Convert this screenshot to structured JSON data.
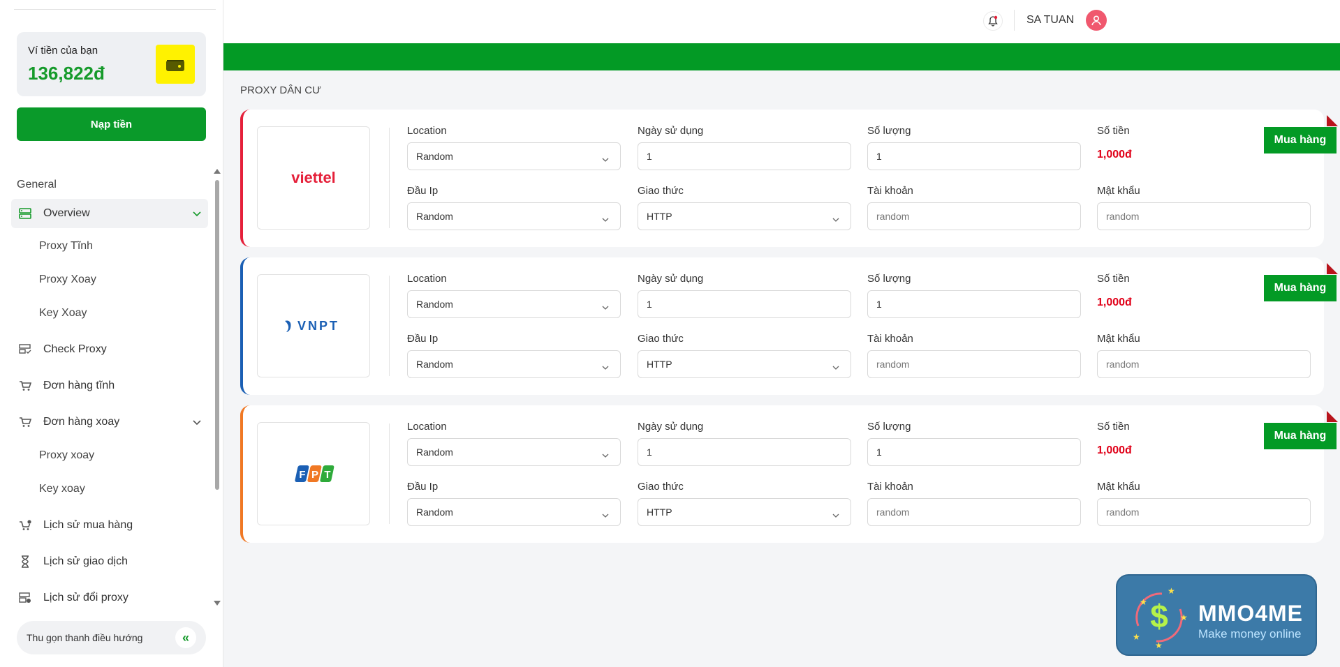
{
  "wallet": {
    "label": "Ví tiền của bạn",
    "amount": "136,822đ",
    "topup_label": "Nạp tiền"
  },
  "nav": {
    "section": "General",
    "items": [
      {
        "label": "Overview",
        "icon": "server-icon",
        "active": true
      },
      {
        "label": "Proxy Tĩnh"
      },
      {
        "label": "Proxy Xoay"
      },
      {
        "label": "Key Xoay"
      },
      {
        "label": "Check Proxy",
        "icon": "check-list-icon"
      },
      {
        "label": "Đơn hàng tĩnh",
        "icon": "cart-icon"
      },
      {
        "label": "Đơn hàng xoay",
        "icon": "cart-icon"
      },
      {
        "label": "Proxy xoay"
      },
      {
        "label": "Key xoay"
      },
      {
        "label": "Lịch sử mua hàng",
        "icon": "cart-history-icon"
      },
      {
        "label": "Lịch sử giao dịch",
        "icon": "hourglass-icon"
      },
      {
        "label": "Lịch sử đổi proxy",
        "icon": "server-history-icon"
      }
    ],
    "collapse_label": "Thu gọn thanh điều hướng"
  },
  "header": {
    "username": "SA TUAN"
  },
  "page_title": "PROXY DÂN CƯ",
  "labels": {
    "location": "Location",
    "days": "Ngày sử dụng",
    "quantity": "Số lượng",
    "price": "Số tiền",
    "ip_prefix": "Đầu Ip",
    "protocol": "Giao thức",
    "account": "Tài khoản",
    "password": "Mật khẩu",
    "buy": "Mua hàng"
  },
  "cards": [
    {
      "provider": "viettel",
      "location": "Random",
      "days": "1",
      "quantity": "1",
      "price": "1,000đ",
      "ip_prefix": "Random",
      "protocol": "HTTP",
      "account_placeholder": "random",
      "password_placeholder": "random"
    },
    {
      "provider": "VNPT",
      "location": "Random",
      "days": "1",
      "quantity": "1",
      "price": "1,000đ",
      "ip_prefix": "Random",
      "protocol": "HTTP",
      "account_placeholder": "random",
      "password_placeholder": "random"
    },
    {
      "provider": "FPT",
      "location": "Random",
      "days": "1",
      "quantity": "1",
      "price": "1,000đ",
      "ip_prefix": "Random",
      "protocol": "HTTP",
      "account_placeholder": "random",
      "password_placeholder": "random"
    }
  ],
  "watermark": {
    "title": "MMO4ME",
    "subtitle": "Make money online"
  },
  "colors": {
    "brand_green": "#039a25",
    "price_red": "#e00018",
    "viettel_red": "#e5203a",
    "vnpt_blue": "#1a5fb4",
    "fpt_orange": "#f07824"
  }
}
